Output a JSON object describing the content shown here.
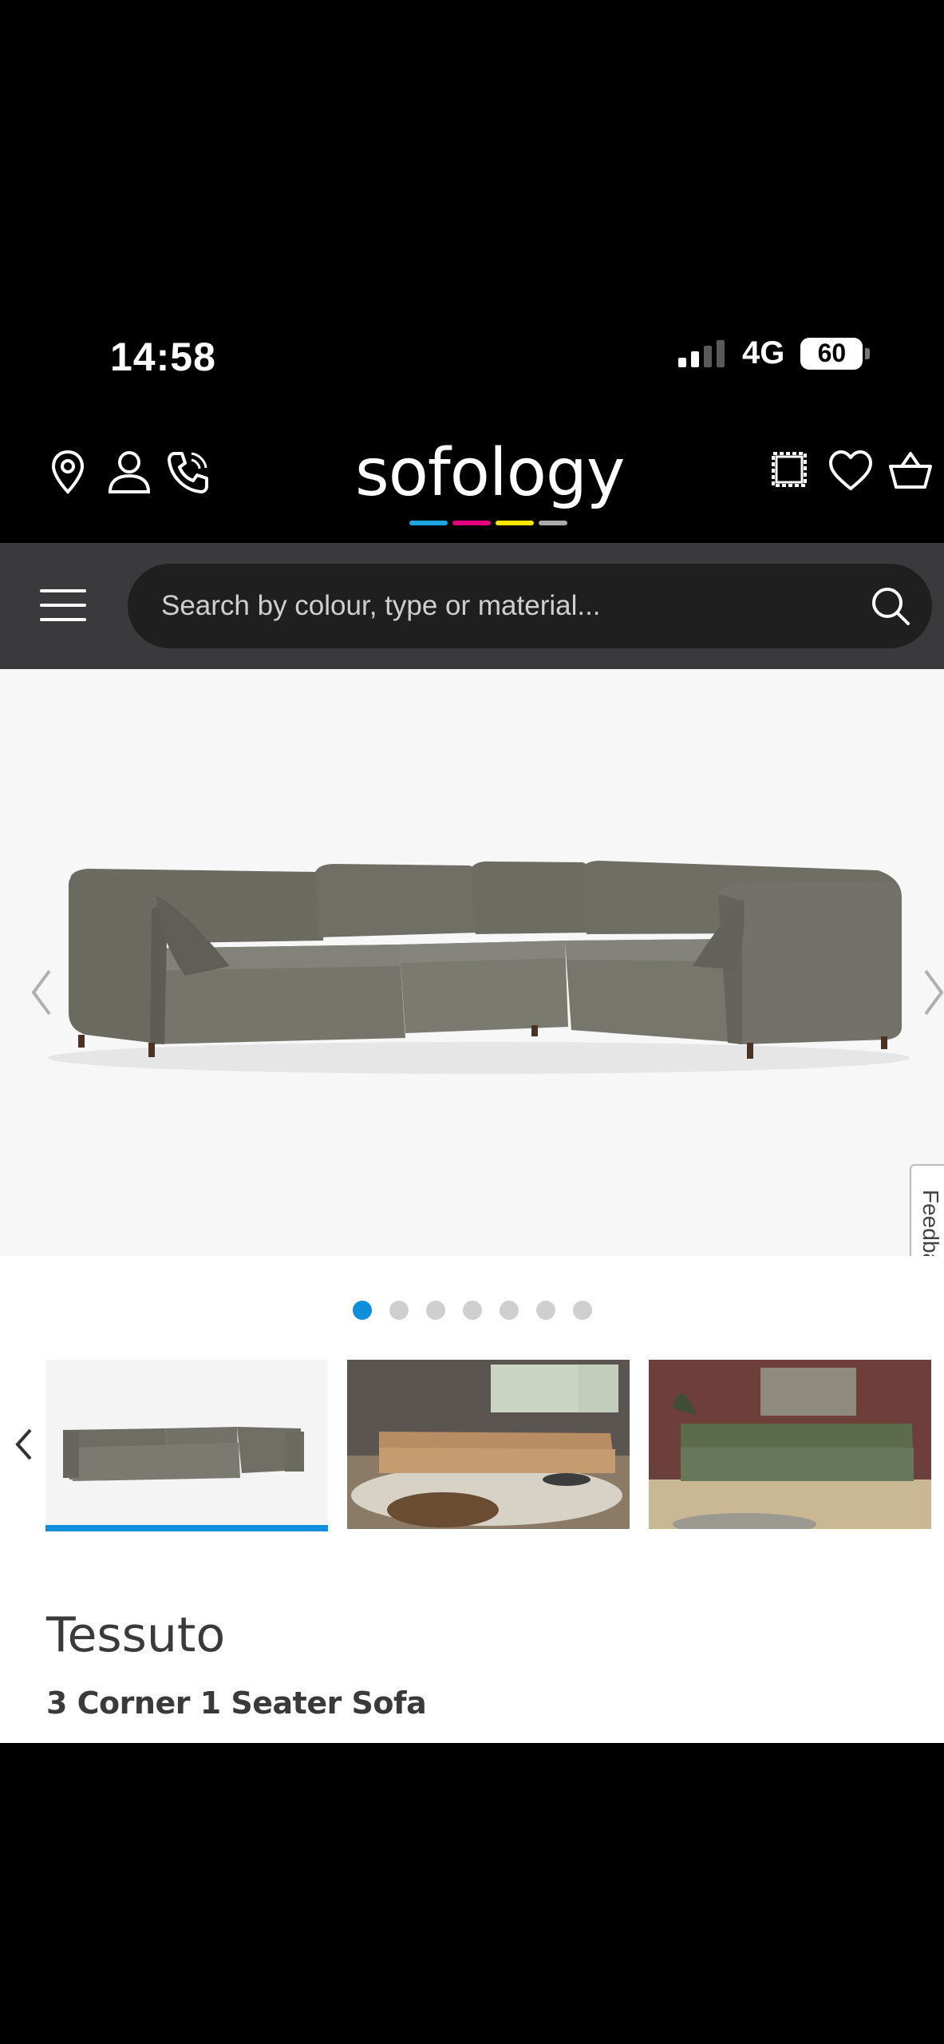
{
  "status_bar": {
    "time": "14:58",
    "network": "4G",
    "battery": "60",
    "signal_bars_filled": 2,
    "signal_bars_total": 4
  },
  "header": {
    "logo": "sofology",
    "logo_stripe_colors": [
      "#1aa7e1",
      "#e6007e",
      "#ffe600",
      "#aaaaaa"
    ],
    "left_icons": [
      "location-pin-icon",
      "account-icon",
      "phone-icon"
    ],
    "right_icons": [
      "swatch-icon",
      "heart-icon",
      "basket-icon"
    ]
  },
  "search": {
    "placeholder": "Search by colour, type or material..."
  },
  "gallery": {
    "total_images": 7,
    "active_index": 0,
    "feedback_label": "Feedback",
    "accent_color": "#0f8edb"
  },
  "thumbnails": [
    {
      "alt": "Tessuto sofa studio shot",
      "active": true
    },
    {
      "alt": "Tan corner sofa in living room",
      "active": false
    },
    {
      "alt": "Green sofa in living room",
      "active": false
    }
  ],
  "product": {
    "name": "Tessuto",
    "subtitle": "3 Corner 1 Seater Sofa"
  }
}
